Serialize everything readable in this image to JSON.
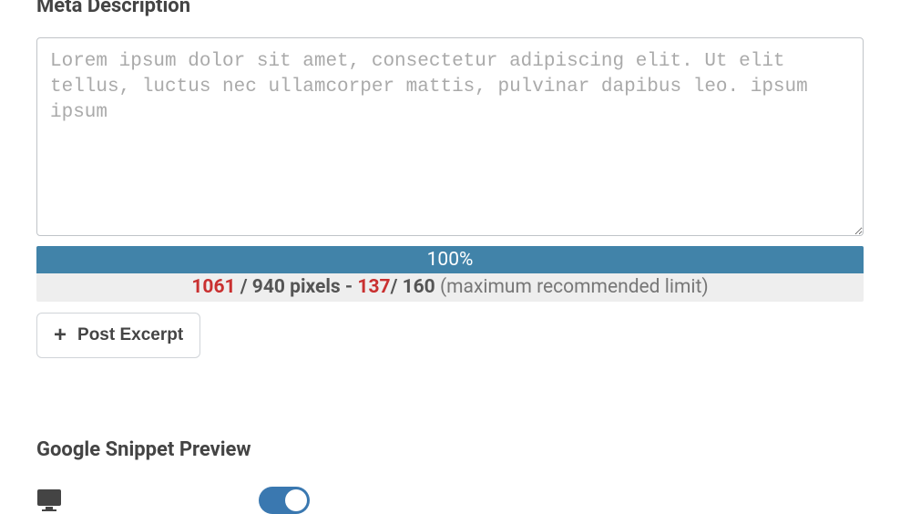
{
  "meta_description": {
    "title": "Meta Description",
    "placeholder": "Lorem ipsum dolor sit amet, consectetur adipiscing elit. Ut elit tellus, luctus nec ullamcorper mattis, pulvinar dapibus leo. ipsum ipsum",
    "value": ""
  },
  "progress": {
    "percent_label": "100%"
  },
  "stats": {
    "pixels_current": "1061",
    "slash1": " / ",
    "pixels_max_label": "940 pixels",
    "dash": " - ",
    "chars_current": "137",
    "slash2": "/ ",
    "chars_max": "160",
    "paren": " (maximum recommended limit)"
  },
  "post_excerpt_button": "Post Excerpt",
  "snippet_preview": {
    "title": "Google Snippet Preview"
  }
}
